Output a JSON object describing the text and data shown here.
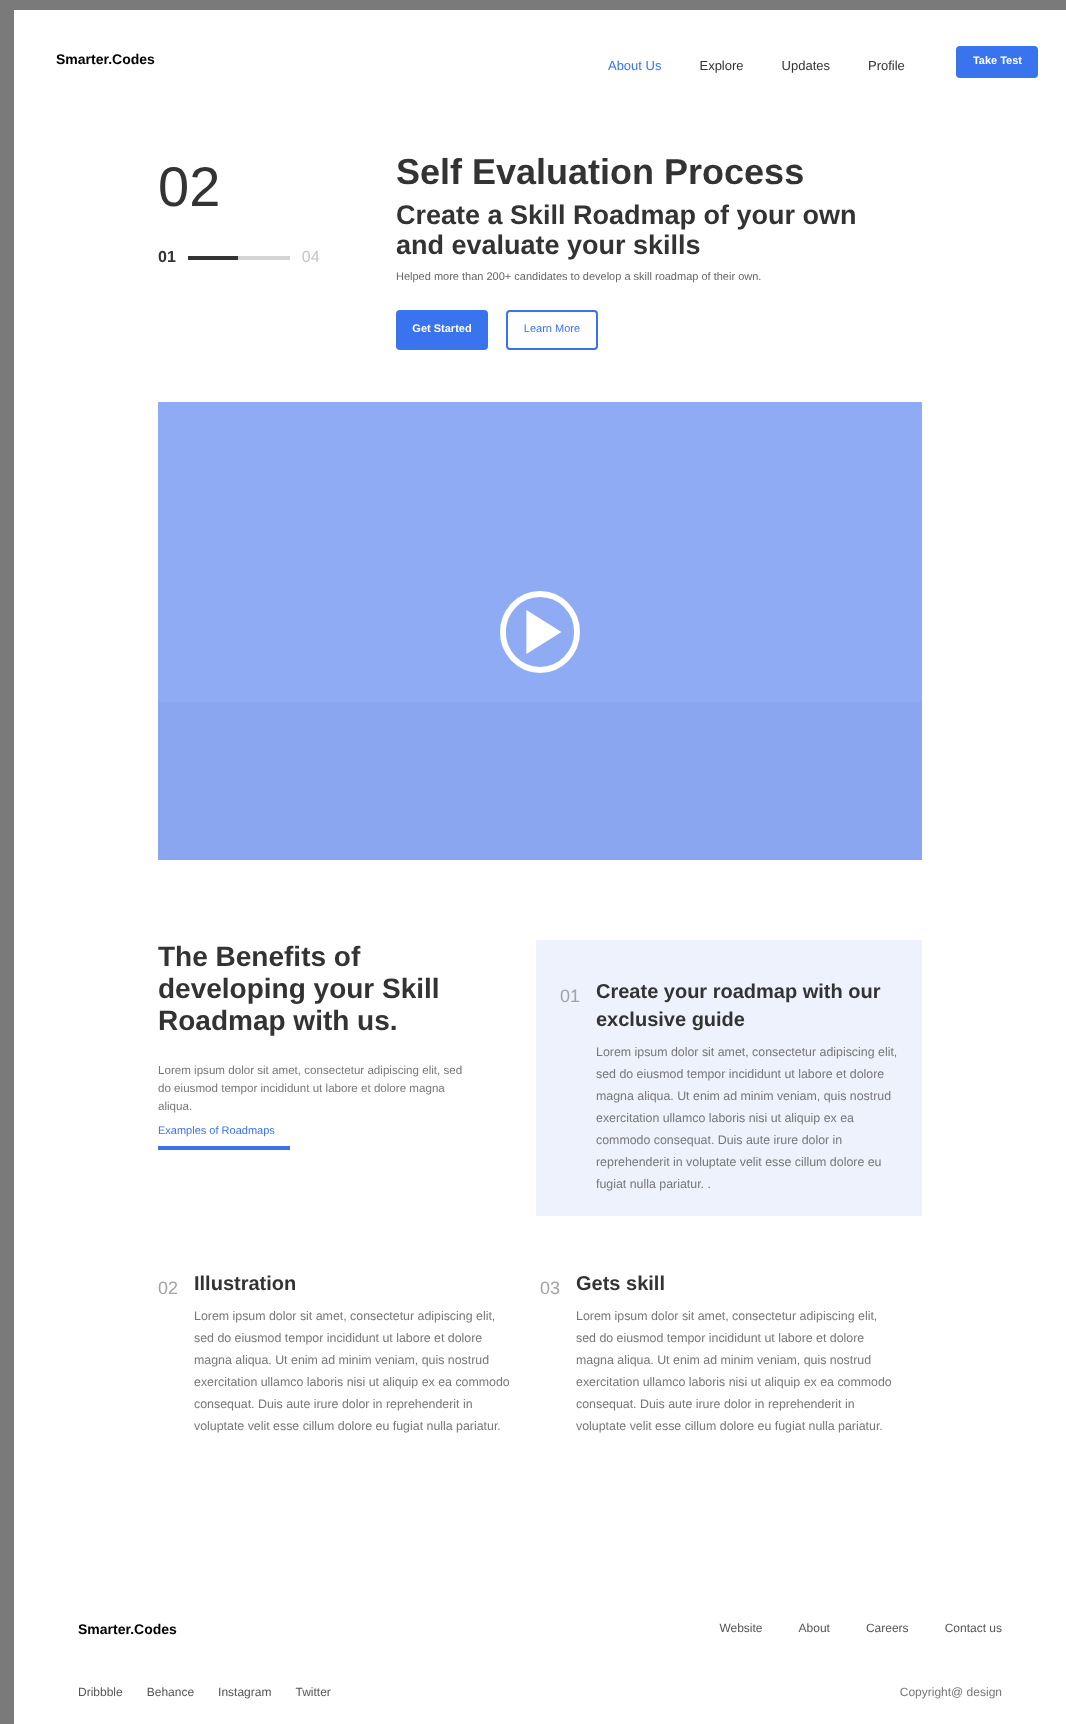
{
  "brand": "Smarter.Codes",
  "nav": [
    {
      "label": "About Us",
      "selected": true
    },
    {
      "label": "Explore",
      "selected": false
    },
    {
      "label": "Updates",
      "selected": false
    },
    {
      "label": "Profile",
      "selected": false
    }
  ],
  "nav_button": "Take Test",
  "hero": {
    "step": "02",
    "progress": {
      "start": "01",
      "end": "04",
      "level": 0.5
    },
    "title": "Self Evaluation Process",
    "subtitle": "Create a Skill Roadmap of your own and evaluate your skills",
    "text": "Helped more than 200+ candidates to develop a skill roadmap of their own.",
    "primary_button": "Get Started",
    "secondary_button": "Learn More"
  },
  "benefits": {
    "title": "The Benefits of developing your Skill Roadmap with us.",
    "text": "Lorem ipsum dolor sit amet, consectetur adipiscing elit, sed do eiusmod tempor incididunt ut labore et dolore magna aliqua.",
    "link": "Examples of Roadmaps"
  },
  "features": [
    {
      "number": "01",
      "title": "Create your roadmap with our exclusive guide",
      "text": "Lorem ipsum dolor sit amet, consectetur adipiscing elit, sed do eiusmod tempor incididunt ut labore et dolore magna aliqua. Ut enim ad minim veniam, quis nostrud exercitation ullamco laboris nisi ut aliquip ex ea commodo consequat. Duis aute irure dolor in reprehenderit in voluptate velit esse cillum dolore eu fugiat nulla pariatur. .",
      "selected": true
    },
    {
      "number": "02",
      "title": "Illustration",
      "text": "Lorem ipsum dolor sit amet, consectetur adipiscing elit, sed do eiusmod tempor incididunt ut labore et dolore magna aliqua. Ut enim ad minim veniam, quis nostrud exercitation ullamco laboris nisi ut aliquip ex ea commodo consequat. Duis aute irure dolor in reprehenderit in voluptate velit esse cillum dolore eu fugiat nulla pariatur.",
      "selected": false
    },
    {
      "number": "03",
      "title": "Gets skill",
      "text": "Lorem ipsum dolor sit amet, consectetur adipiscing elit, sed do eiusmod tempor incididunt ut labore et dolore magna aliqua. Ut enim ad minim veniam, quis nostrud exercitation ullamco laboris nisi ut aliquip ex ea commodo consequat. Duis aute irure dolor in reprehenderit in voluptate velit esse cillum dolore eu fugiat nulla pariatur.",
      "selected": false
    }
  ],
  "footer": {
    "brand": "Smarter.Codes",
    "links": [
      "Website",
      "About",
      "Careers",
      "Contact us"
    ],
    "social": [
      "Dribbble",
      "Behance",
      "Instagram",
      "Twitter"
    ],
    "copyright": "Copyright@ design"
  }
}
